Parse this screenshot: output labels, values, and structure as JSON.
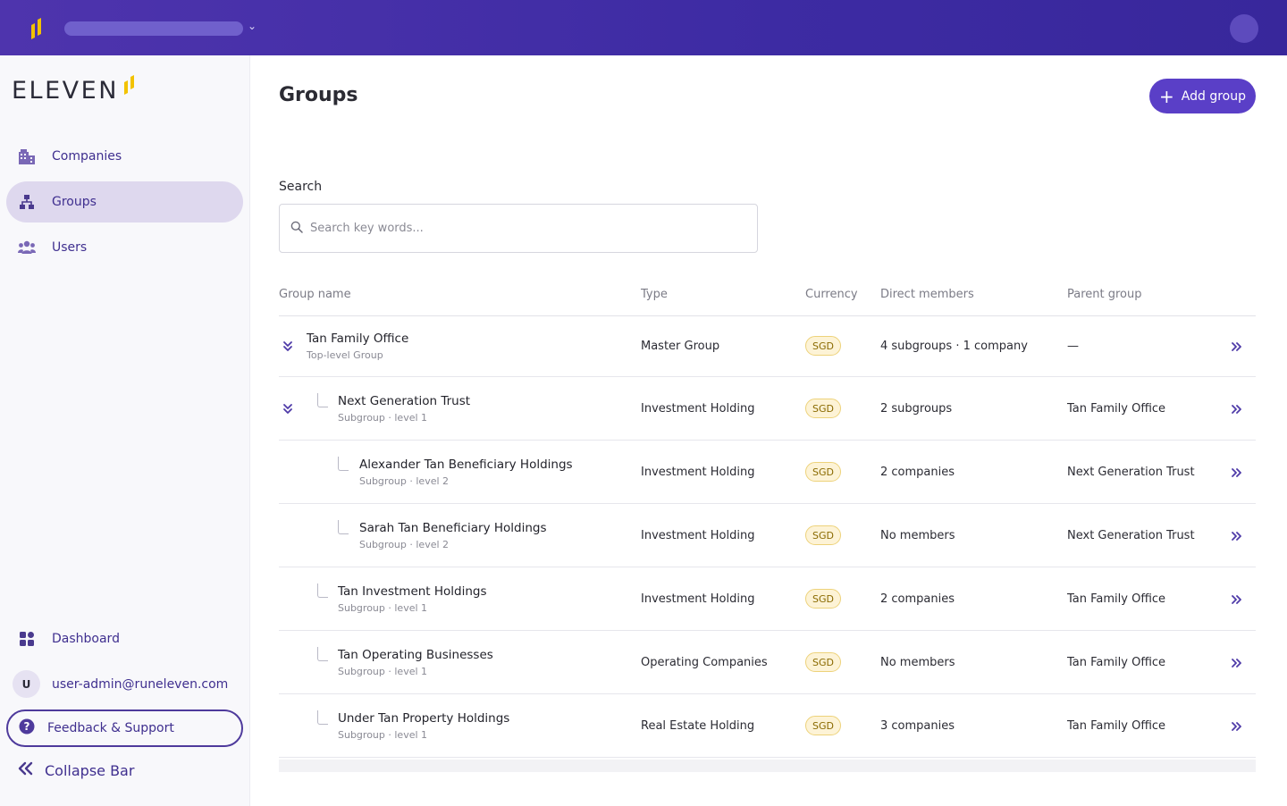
{
  "colors": {
    "topbar": "#4e34ad",
    "accent": "#5a3fc7",
    "active_nav": "#ded8ee",
    "badge_bg": "#fdf3d6",
    "brand_yellow": "#f2c200"
  },
  "brand": {
    "name": "ELEVEN"
  },
  "sidebar": {
    "items": [
      {
        "label": "Companies",
        "icon": "building-icon"
      },
      {
        "label": "Groups",
        "icon": "hierarchy-icon",
        "active": true
      },
      {
        "label": "Users",
        "icon": "users-icon"
      }
    ],
    "dashboard_label": "Dashboard",
    "user": {
      "initial": "U",
      "email": "user-admin@runeleven.com"
    },
    "feedback_label": "Feedback & Support",
    "collapse_label": "Collapse Bar"
  },
  "page": {
    "title": "Groups",
    "add_label": "Add group"
  },
  "search": {
    "label": "Search",
    "placeholder": "Search key words..."
  },
  "table": {
    "headers": {
      "name": "Group name",
      "type": "Type",
      "currency": "Currency",
      "members": "Direct members",
      "parent": "Parent group"
    },
    "rows": [
      {
        "name": "Tan Family Office",
        "sub": "Top-level Group",
        "type": "Master Group",
        "currency": "SGD",
        "members": "4 subgroups · 1 company",
        "parent": "—"
      },
      {
        "name": "Next Generation Trust",
        "sub": "Subgroup · level 1",
        "type": "Investment Holding",
        "currency": "SGD",
        "members": "2 subgroups",
        "parent": "Tan Family Office"
      },
      {
        "name": "Alexander Tan Beneficiary Holdings",
        "sub": "Subgroup · level 2",
        "type": "Investment Holding",
        "currency": "SGD",
        "members": "2 companies",
        "parent": "Next Generation Trust"
      },
      {
        "name": "Sarah Tan Beneficiary Holdings",
        "sub": "Subgroup · level 2",
        "type": "Investment Holding",
        "currency": "SGD",
        "members": "No members",
        "parent": "Next Generation Trust"
      },
      {
        "name": "Tan Investment Holdings",
        "sub": "Subgroup · level 1",
        "type": "Investment Holding",
        "currency": "SGD",
        "members": "2 companies",
        "parent": "Tan Family Office"
      },
      {
        "name": "Tan Operating Businesses",
        "sub": "Subgroup · level 1",
        "type": "Operating Companies",
        "currency": "SGD",
        "members": "No members",
        "parent": "Tan Family Office"
      },
      {
        "name": "Under Tan Property Holdings",
        "sub": "Subgroup · level 1",
        "type": "Real Estate Holding",
        "currency": "SGD",
        "members": "3 companies",
        "parent": "Tan Family Office"
      }
    ]
  }
}
